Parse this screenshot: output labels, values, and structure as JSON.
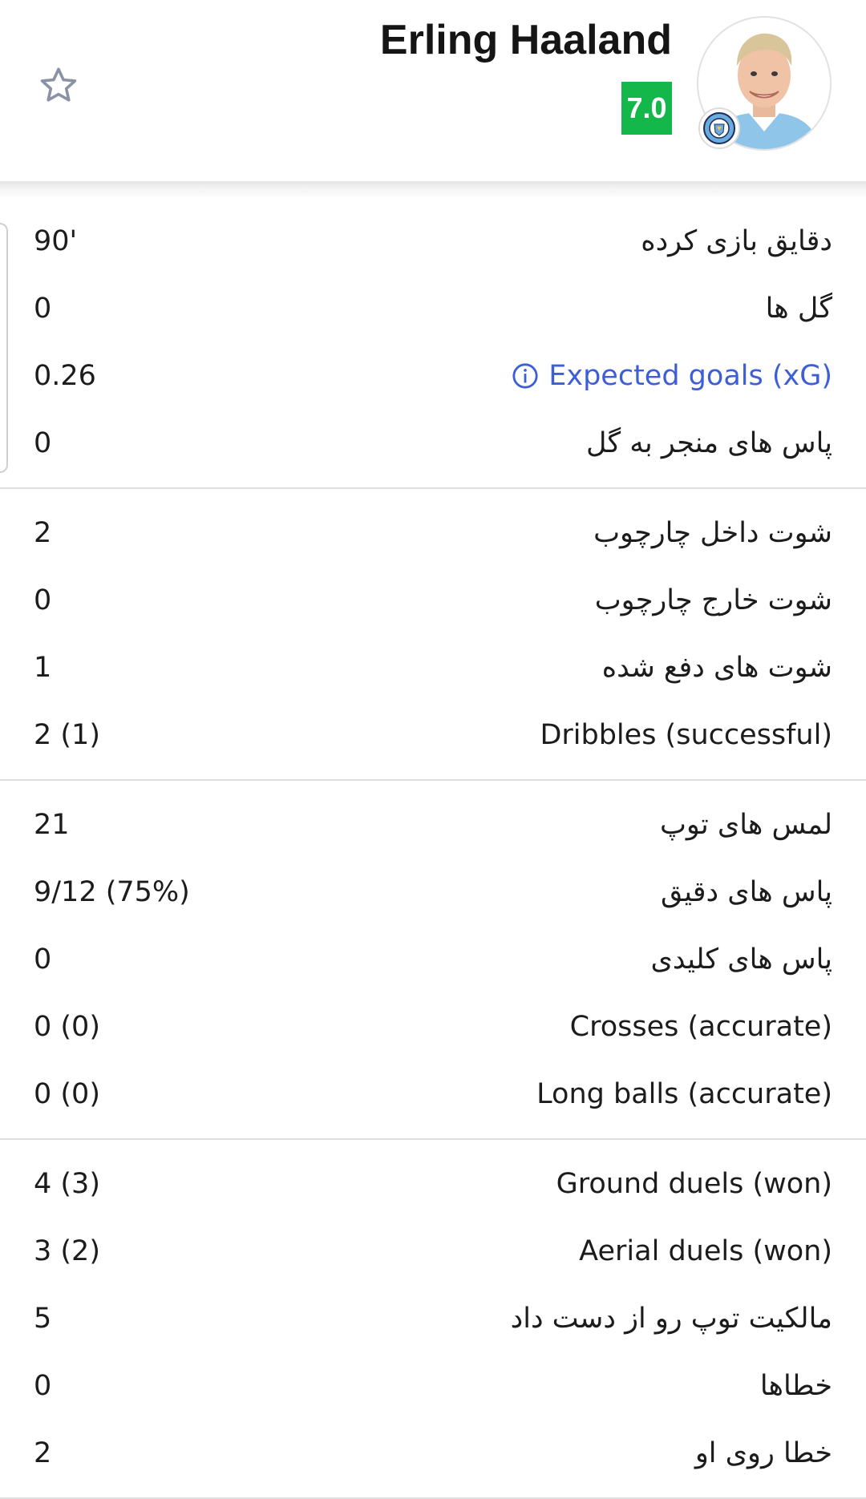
{
  "player": {
    "name": "Erling Haaland",
    "rating": "7.0",
    "rating_color": "#14b84a",
    "avatar_icon": "player-photo",
    "club_icon": "manchester-city-badge"
  },
  "header": {
    "favorite_icon": "star-outline-icon"
  },
  "colors": {
    "link": "#3d5ed6",
    "divider": "#dedede",
    "text": "#1c1c1c"
  },
  "stat_groups": [
    {
      "rows": [
        {
          "label": "دقایق بازی کرده",
          "value": "90'"
        },
        {
          "label": "گل ها",
          "value": "0"
        },
        {
          "label": "Expected goals (xG)",
          "value": "0.26",
          "link": true,
          "icon": "info-icon"
        },
        {
          "label": "پاس های منجر به گل",
          "value": "0"
        }
      ]
    },
    {
      "rows": [
        {
          "label": "شوت داخل چارچوب",
          "value": "2"
        },
        {
          "label": "شوت خارج چارچوب",
          "value": "0"
        },
        {
          "label": "شوت های دفع شده",
          "value": "1"
        },
        {
          "label": "Dribbles (successful)",
          "value": "2 (1)"
        }
      ]
    },
    {
      "rows": [
        {
          "label": "لمس های توپ",
          "value": "21"
        },
        {
          "label": "پاس های دقیق",
          "value": "9/12 (75%)"
        },
        {
          "label": "پاس های کلیدی",
          "value": "0"
        },
        {
          "label": "Crosses (accurate)",
          "value": "0 (0)"
        },
        {
          "label": "Long balls (accurate)",
          "value": "0 (0)"
        }
      ]
    },
    {
      "rows": [
        {
          "label": "Ground duels (won)",
          "value": "4 (3)"
        },
        {
          "label": "Aerial duels (won)",
          "value": "3 (2)"
        },
        {
          "label": "مالکیت توپ رو از دست داد",
          "value": "5"
        },
        {
          "label": "خطاها",
          "value": "0"
        },
        {
          "label": "خطا روی او",
          "value": "2"
        }
      ]
    }
  ]
}
